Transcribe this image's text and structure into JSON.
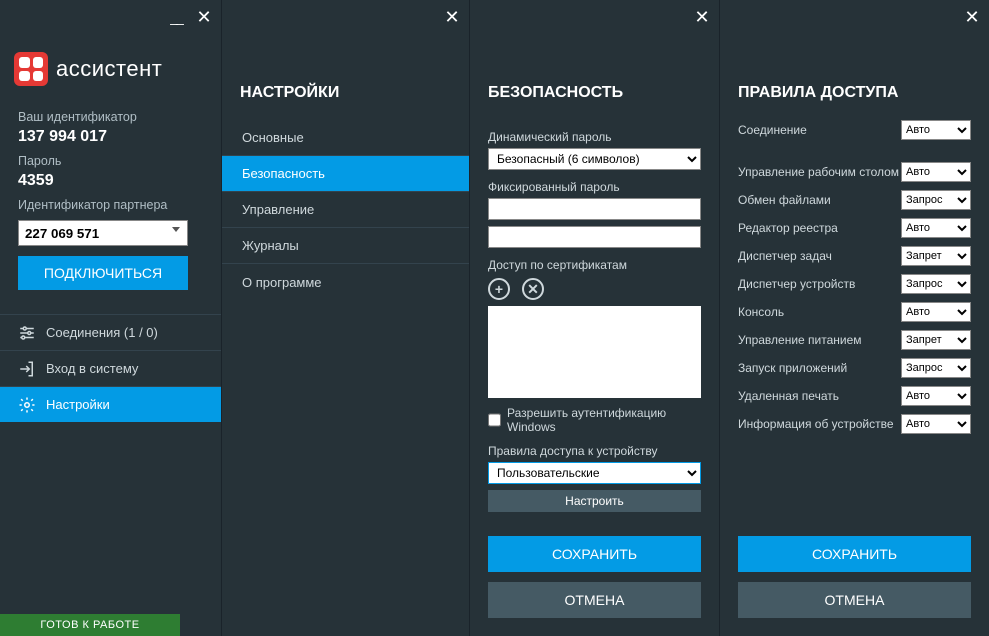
{
  "app": {
    "name": "ассистент"
  },
  "main": {
    "id_label": "Ваш идентификатор",
    "id_value": "137 994 017",
    "password_label": "Пароль",
    "password_value": "4359",
    "partner_label": "Идентификатор партнера",
    "partner_value": "227 069 571",
    "connect_btn": "ПОДКЛЮЧИТЬСЯ",
    "nav": {
      "connections": "Соединения (1 / 0)",
      "login": "Вход в систему",
      "settings": "Настройки"
    },
    "status": "ГОТОВ К РАБОТЕ"
  },
  "settings": {
    "title": "НАСТРОЙКИ",
    "items": {
      "basic": "Основные",
      "security": "Безопасность",
      "control": "Управление",
      "logs": "Журналы",
      "about": "О программе"
    }
  },
  "security": {
    "title": "БЕЗОПАСНОСТЬ",
    "dyn_pw_label": "Динамический пароль",
    "dyn_pw_value": "Безопасный (6 символов)",
    "fixed_pw_label": "Фиксированный пароль",
    "cert_label": "Доступ по сертификатам",
    "win_auth": "Разрешить аутентификацию Windows",
    "rules_label": "Правила доступа к устройству",
    "rules_value": "Пользовательские",
    "configure": "Настроить",
    "save": "СОХРАНИТЬ",
    "cancel": "ОТМЕНА"
  },
  "access": {
    "title": "ПРАВИЛА ДОСТУПА",
    "rows": [
      {
        "label": "Соединение",
        "value": "Авто"
      },
      {
        "label": "Управление рабочим столом",
        "value": "Авто"
      },
      {
        "label": "Обмен файлами",
        "value": "Запрос"
      },
      {
        "label": "Редактор реестра",
        "value": "Авто"
      },
      {
        "label": "Диспетчер задач",
        "value": "Запрет"
      },
      {
        "label": "Диспетчер устройств",
        "value": "Запрос"
      },
      {
        "label": "Консоль",
        "value": "Авто"
      },
      {
        "label": "Управление питанием",
        "value": "Запрет"
      },
      {
        "label": "Запуск приложений",
        "value": "Запрос"
      },
      {
        "label": "Удаленная печать",
        "value": "Авто"
      },
      {
        "label": "Информация об устройстве",
        "value": "Авто"
      }
    ],
    "save": "СОХРАНИТЬ",
    "cancel": "ОТМЕНА"
  }
}
